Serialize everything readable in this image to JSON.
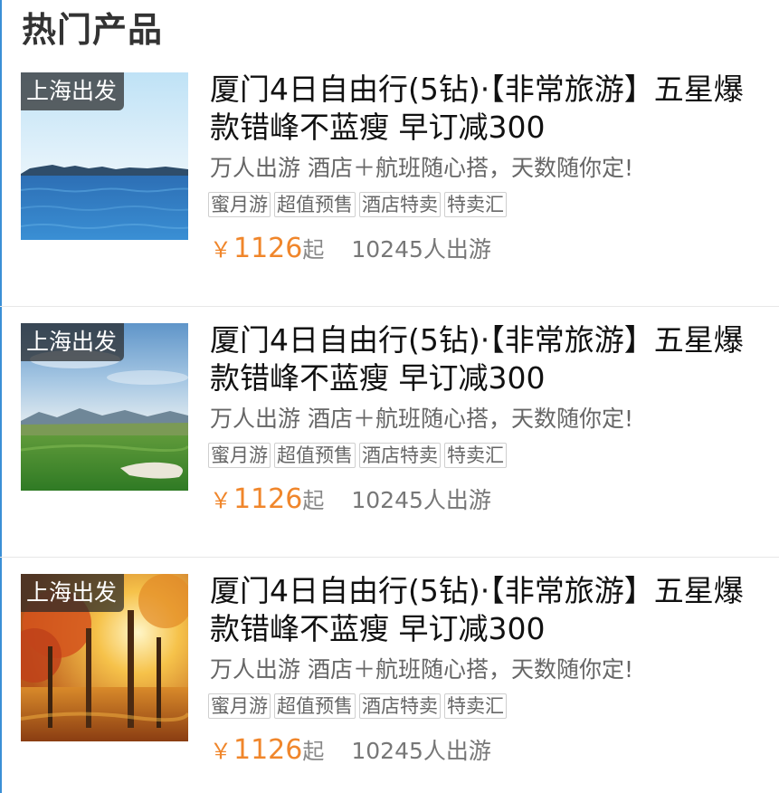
{
  "section": {
    "title": "热门产品"
  },
  "products": [
    {
      "scene": "sea",
      "departure_tag": "上海出发",
      "title": "厦门4日自由行(5钻)·【非常旅游】五星爆款错峰不蓝瘦 早订减300",
      "subtitle": "万人出游 酒店＋航班随心搭，天数随你定!",
      "tags": [
        "蜜月游",
        "超值预售",
        "酒店特卖",
        "特卖汇"
      ],
      "currency": "￥",
      "price": "1126",
      "price_suffix": "起",
      "travelers": "10245人出游"
    },
    {
      "scene": "golf",
      "departure_tag": "上海出发",
      "title": "厦门4日自由行(5钻)·【非常旅游】五星爆款错峰不蓝瘦 早订减300",
      "subtitle": "万人出游 酒店＋航班随心搭，天数随你定!",
      "tags": [
        "蜜月游",
        "超值预售",
        "酒店特卖",
        "特卖汇"
      ],
      "currency": "￥",
      "price": "1126",
      "price_suffix": "起",
      "travelers": "10245人出游"
    },
    {
      "scene": "autumn",
      "departure_tag": "上海出发",
      "title": "厦门4日自由行(5钻)·【非常旅游】五星爆款错峰不蓝瘦 早订减300",
      "subtitle": "万人出游 酒店＋航班随心搭，天数随你定!",
      "tags": [
        "蜜月游",
        "超值预售",
        "酒店特卖",
        "特卖汇"
      ],
      "currency": "￥",
      "price": "1126",
      "price_suffix": "起",
      "travelers": "10245人出游"
    }
  ],
  "colors": {
    "price": "#f0862b",
    "accent_edge": "#3b8fd6"
  }
}
